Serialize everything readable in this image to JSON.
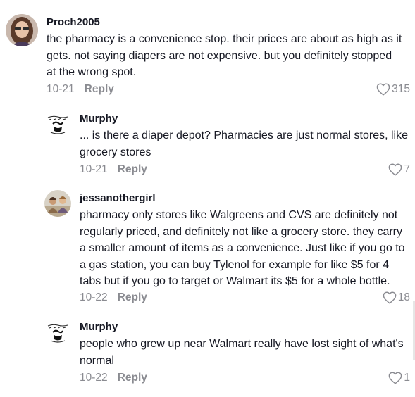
{
  "comments": [
    {
      "username": "Proch2005",
      "text": "the pharmacy is a convenience stop. their prices are about as high as it gets. not saying diapers are not expensive. but you definitely stopped at the wrong spot.",
      "date": "10-21",
      "reply_label": "Reply",
      "likes": "315",
      "avatar": "user-photo-avatar"
    },
    {
      "username": "Murphy",
      "text": "... is there a diaper depot? Pharmacies are just normal stores, like grocery stores",
      "date": "10-21",
      "reply_label": "Reply",
      "likes": "7",
      "avatar": "sketch-logo-avatar"
    },
    {
      "username": "jessanothergirl",
      "text": "pharmacy only stores like Walgreens and CVS are definitely not regularly priced, and definitely not like a grocery store. they carry a smaller amount of items as a convenience. Just like if you go to a gas station, you can buy Tylenol for example for like $5 for 4 tabs but if you go to target or Walmart its $5 for a whole bottle.",
      "date": "10-22",
      "reply_label": "Reply",
      "likes": "18",
      "avatar": "group-photo-avatar"
    },
    {
      "username": "Murphy",
      "text": "people who grew up near Walmart really have lost sight of what's normal",
      "date": "10-22",
      "reply_label": "Reply",
      "likes": "1",
      "avatar": "sketch-logo-avatar"
    }
  ],
  "icons": {
    "like": "heart-outline-icon"
  },
  "colors": {
    "text": "#161823",
    "muted": "#8a8b91"
  }
}
